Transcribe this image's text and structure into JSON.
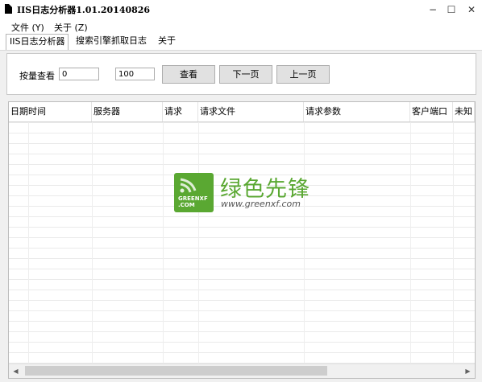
{
  "window": {
    "title": "IIS日志分析器1.01.20140826",
    "controls": {
      "minimize": "−",
      "maximize": "☐",
      "close": "✕"
    }
  },
  "menu": {
    "items": [
      {
        "label": "文件 (Y)"
      },
      {
        "label": "关于 (Z)"
      }
    ]
  },
  "tabs": [
    {
      "label": "IIS日志分析器",
      "active": true
    },
    {
      "label": "搜索引擎抓取日志",
      "active": false
    },
    {
      "label": "关于",
      "active": false
    }
  ],
  "query": {
    "label": "按量查看",
    "start_value": "0",
    "count_value": "100",
    "view_button": "查看",
    "next_button": "下一页",
    "prev_button": "上一页"
  },
  "table": {
    "columns": [
      "日期时间",
      "服务器",
      "请求",
      "请求文件",
      "请求参数",
      "客户端口",
      "未知"
    ]
  },
  "watermark": {
    "name": "绿色先锋",
    "url": "www.greenxf.com",
    "logo_text_1": "GREENXF",
    "logo_text_2": ".COM",
    "color": "#5aa832"
  },
  "scrollbar": {
    "left_arrow": "◀",
    "right_arrow": "▶"
  }
}
